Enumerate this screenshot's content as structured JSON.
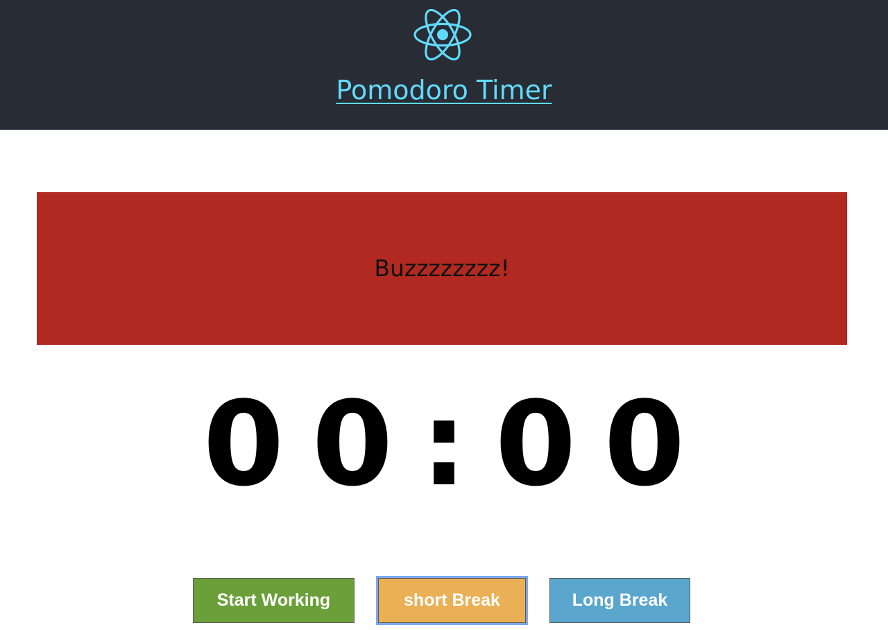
{
  "header": {
    "logo_icon": "react-atom-icon",
    "title": "Pomodoro Timer",
    "background": "#282c34",
    "accent": "#61dafb"
  },
  "alert": {
    "message": "Buzzzzzzzz!",
    "background": "#b22922"
  },
  "timer": {
    "display": "00:00",
    "minutes": "00",
    "seconds": "00"
  },
  "controls": {
    "start_working_label": "Start Working",
    "short_break_label": "short Break",
    "long_break_label": "Long Break",
    "start_working_color": "#6b9f3a",
    "short_break_color": "#e9b055",
    "long_break_color": "#5aa6cd",
    "focused_button": "short Break"
  }
}
